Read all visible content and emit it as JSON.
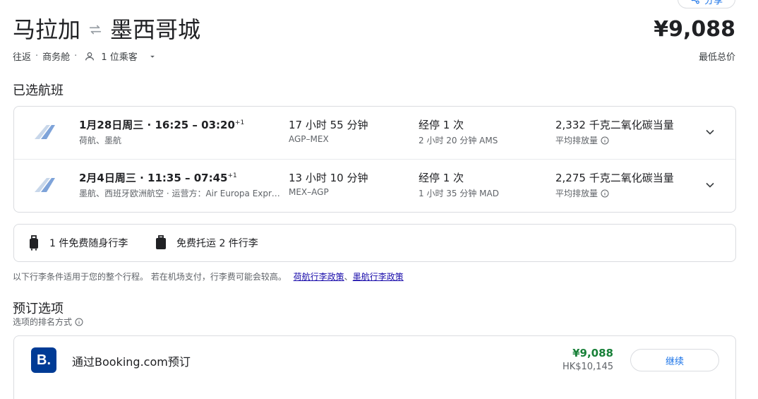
{
  "header": {
    "share_label": "分享",
    "origin": "马拉加",
    "destination": "墨西哥城",
    "trip_type": "往返",
    "cabin": "商务舱",
    "passengers": "1 位乘客",
    "price": "¥9,088",
    "price_label": "最低总价"
  },
  "selected": {
    "title": "已选航班",
    "flights": [
      {
        "date_time": "1月28日周三 · 16:25 – 03:20",
        "day_offset": "+1",
        "airlines": "荷航、墨航",
        "duration": "17 小时 55 分钟",
        "route": "AGP–MEX",
        "stops": "经停 1 次",
        "layover": "2 小时 20 分钟 AMS",
        "emissions": "2,332 千克二氧化碳当量",
        "emissions_label": "平均排放量"
      },
      {
        "date_time": "2月4日周三 · 11:35 – 07:45",
        "day_offset": "+1",
        "airlines": "墨航、西班牙欧洲航空 · 运营方：Air Europa Express",
        "duration": "13 小时 10 分钟",
        "route": "MEX–AGP",
        "stops": "经停 1 次",
        "layover": "1 小时 35 分钟 MAD",
        "emissions": "2,275 千克二氧化碳当量",
        "emissions_label": "平均排放量"
      }
    ]
  },
  "baggage": {
    "carry_on": "1 件免费随身行李",
    "checked": "免费托运 2 件行李",
    "note": "以下行李条件适用于您的整个行程。 若在机场支付，行李费可能会较高。",
    "link1": "荷航行李政策",
    "separator": "、",
    "link2": "墨航行李政策"
  },
  "booking": {
    "title": "预订选项",
    "sort_label": "选项的排名方式",
    "options": [
      {
        "logo_letter": "B.",
        "name": "通过Booking.com预订",
        "price": "¥9,088",
        "price_alt": "HK$10,145",
        "button": "继续"
      }
    ]
  },
  "colors": {
    "accent": "#1a73e8",
    "price_green": "#188038",
    "booking_blue": "#003b95"
  }
}
